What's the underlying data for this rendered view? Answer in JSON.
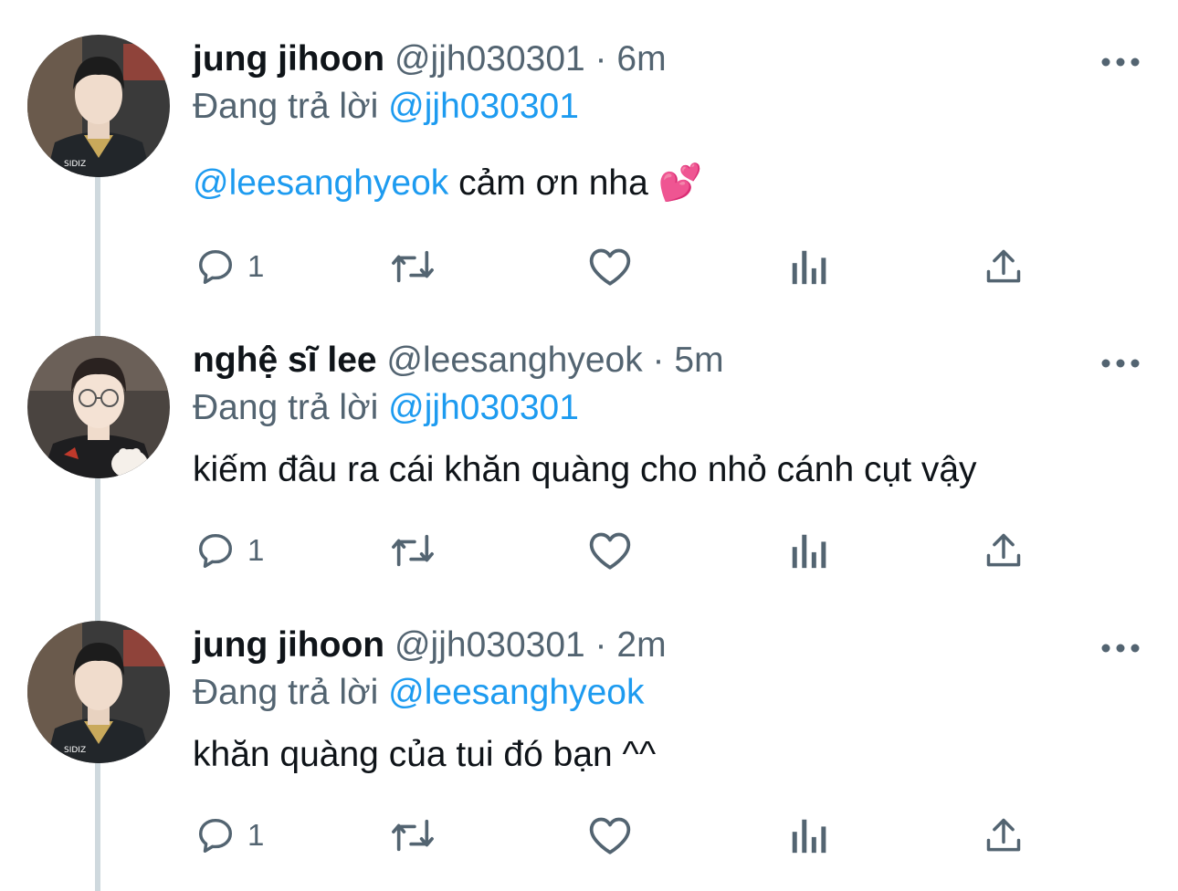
{
  "tweets": [
    {
      "name": "jung jihoon",
      "handle": "@jjh030301",
      "separator": " · ",
      "time": "6m",
      "replying_prefix": "Đang trả lời ",
      "replying_to": "@jjh030301",
      "text_mention": "@leesanghyeok",
      "text": " cảm ơn nha 💕",
      "reply_count": "1",
      "avatar_icon": "avatar-jung-jihoon"
    },
    {
      "name": "nghệ sĩ lee",
      "handle": "@leesanghyeok",
      "separator": " · ",
      "time": "5m",
      "replying_prefix": "Đang trả lời ",
      "replying_to": "@jjh030301",
      "text": "kiếm đâu ra cái khăn quàng cho nhỏ cánh cụt vậy",
      "reply_count": "1",
      "avatar_icon": "avatar-nghe-si-lee"
    },
    {
      "name": "jung jihoon",
      "handle": "@jjh030301",
      "separator": " · ",
      "time": "2m",
      "replying_prefix": "Đang trả lời ",
      "replying_to": "@leesanghyeok",
      "text": "khăn quàng của tui đó bạn ^^",
      "reply_count": "1",
      "avatar_icon": "avatar-jung-jihoon"
    }
  ],
  "icons": {
    "more": "more-horizontal-icon",
    "reply": "reply-bubble-icon",
    "retweet": "retweet-icon",
    "like": "heart-icon",
    "analytics": "analytics-bars-icon",
    "share": "share-upload-icon"
  },
  "colors": {
    "link": "#1d9bf0",
    "secondary_text": "#536471",
    "primary_text": "#0f1419",
    "thread_line": "#cfd9de"
  }
}
